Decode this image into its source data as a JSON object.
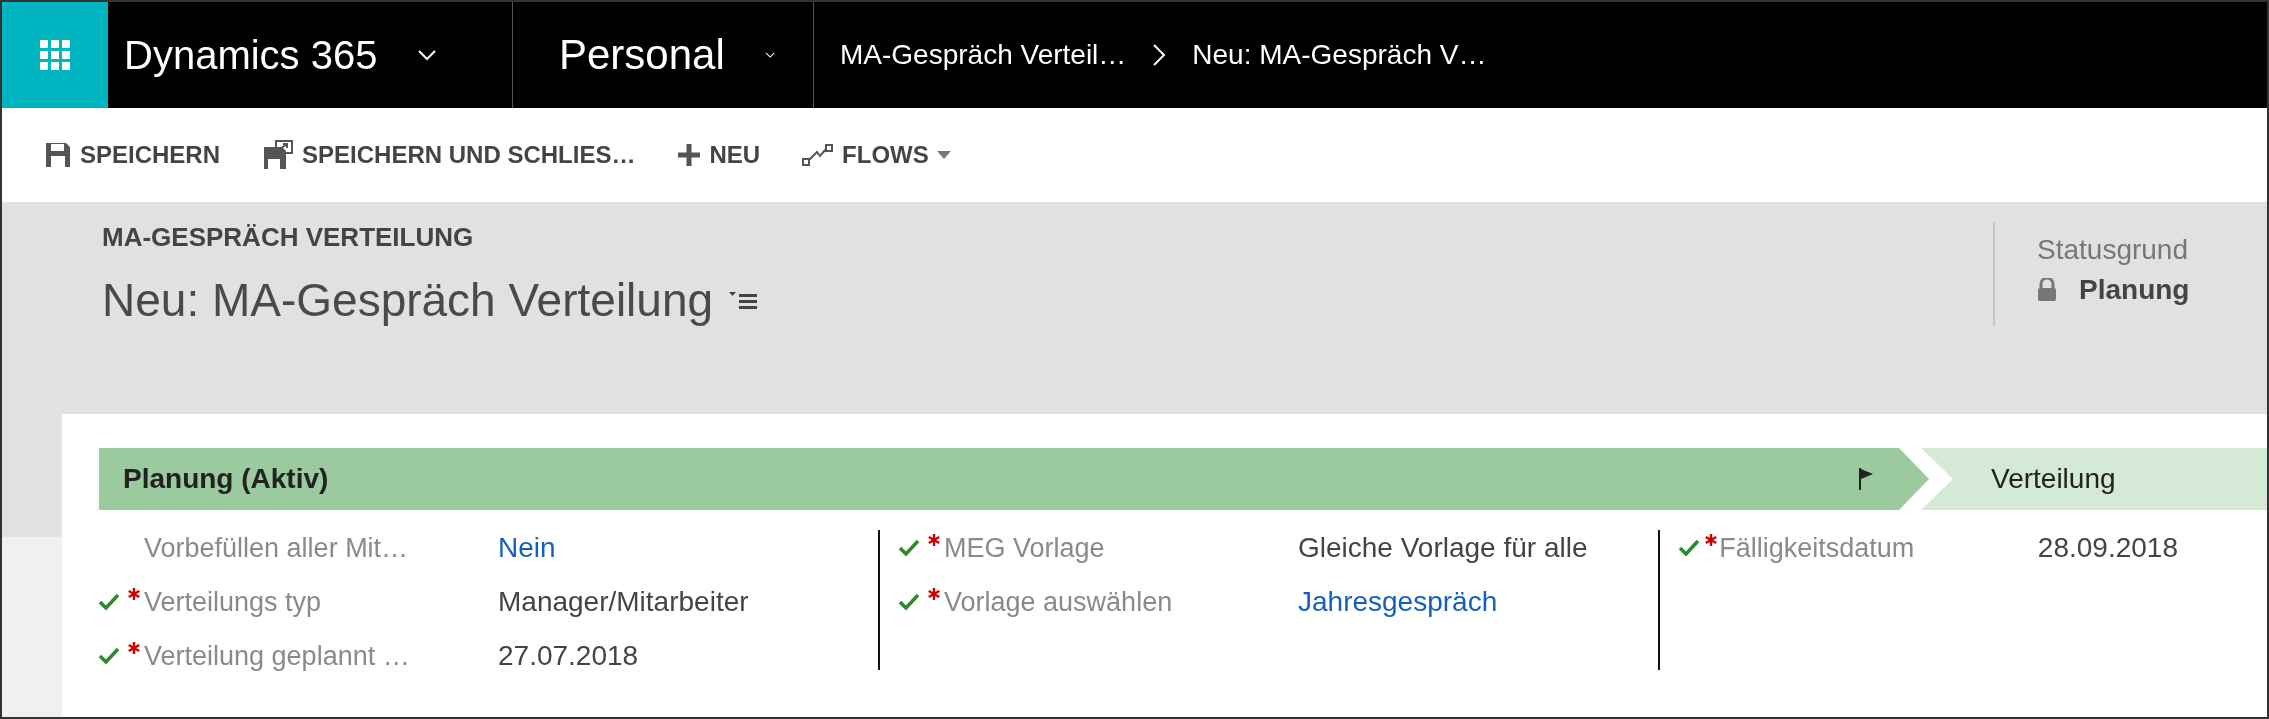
{
  "navbar": {
    "app": "Dynamics 365",
    "area": "Personal",
    "breadcrumbs": [
      {
        "label": "MA-Gespräch Verteil…"
      },
      {
        "label": "Neu: MA-Gespräch V…"
      }
    ]
  },
  "toolbar": [
    {
      "kind": "save",
      "label": "SPEICHERN"
    },
    {
      "kind": "save-close",
      "label": "SPEICHERN UND SCHLIES…"
    },
    {
      "kind": "new",
      "label": "NEU"
    },
    {
      "kind": "flows",
      "label": "FLOWS"
    }
  ],
  "header": {
    "entity": "MA-GESPRÄCH VERTEILUNG",
    "title": "Neu: MA-Gespräch Verteilung",
    "status_label": "Statusgrund",
    "status_value": "Planung"
  },
  "stages": [
    {
      "label": "Planung (Aktiv)",
      "selected": true
    },
    {
      "label": "Verteilung",
      "selected": false
    }
  ],
  "columns": [
    [
      {
        "label": "Vorbefüllen aller Mit…",
        "value": "Nein",
        "required": false,
        "checked": false,
        "kind": "link"
      },
      {
        "label": "Verteilungs typ",
        "value": "Manager/Mitarbeiter",
        "required": true,
        "checked": true,
        "kind": "text"
      },
      {
        "label": "Verteilung geplannt …",
        "value": "27.07.2018",
        "required": true,
        "checked": true,
        "kind": "text"
      }
    ],
    [
      {
        "label": "MEG Vorlage",
        "value": "Gleiche Vorlage für alle",
        "required": true,
        "checked": true,
        "kind": "text"
      },
      {
        "label": "Vorlage auswählen",
        "value": "Jahresgespräch",
        "required": true,
        "checked": true,
        "kind": "link"
      }
    ],
    [
      {
        "label": "Fälligkeitsdatum",
        "value": "28.09.2018",
        "required": true,
        "checked": true,
        "kind": "text"
      }
    ]
  ]
}
